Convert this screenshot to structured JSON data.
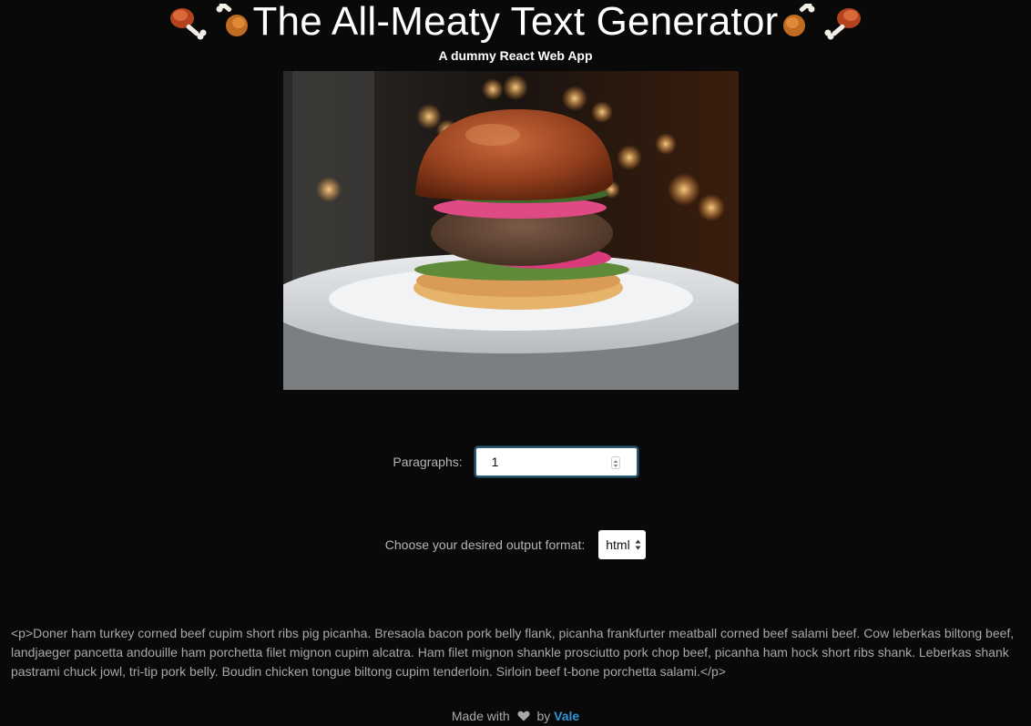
{
  "header": {
    "title": "The All-Meaty Text Generator",
    "subtitle": "A dummy React Web App",
    "decoration_icon": "poultry-leg-emoji"
  },
  "hero": {
    "image_icon": "burger-photo"
  },
  "form": {
    "paragraphs_label": "Paragraphs:",
    "paragraphs_value": "1",
    "format_label": "Choose your desired output format:",
    "format_selected": "html"
  },
  "output": {
    "text": "<p>Doner ham turkey corned beef cupim short ribs pig picanha. Bresaola bacon pork belly flank, picanha frankfurter meatball corned beef salami beef. Cow leberkas biltong beef, landjaeger pancetta andouille ham porchetta filet mignon cupim alcatra. Ham filet mignon shankle prosciutto pork chop beef, picanha ham hock short ribs shank. Leberkas shank pastrami chuck jowl, tri-tip pork belly. Boudin chicken tongue biltong cupim tenderloin. Sirloin beef t-bone porchetta salami.</p>"
  },
  "footer": {
    "made_with": "Made with",
    "heart_icon": "heart-icon",
    "by": "by",
    "author": "Vale"
  },
  "colors": {
    "background": "#090909",
    "link": "#2f95d8",
    "muted_text": "#a8a8a8",
    "focus_border": "#2c5873"
  }
}
